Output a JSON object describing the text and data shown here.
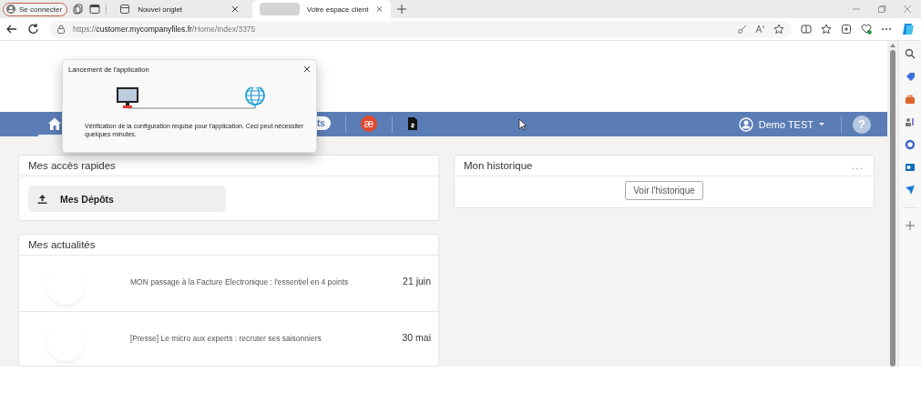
{
  "browser": {
    "profile_button": "Se connecter",
    "tabs": [
      {
        "label": "Nouvel onglet",
        "selected": false
      },
      {
        "label": "Votre espace client",
        "selected": true
      }
    ],
    "url": "https://**customer.mycompanyfiles.fr**/Home/Index/3375"
  },
  "nav": {
    "items": [
      {
        "kind": "home",
        "selected": true
      },
      {
        "kind": "pill",
        "label": "ts",
        "selected": false
      },
      {
        "kind": "logo",
        "label": "æ",
        "selected": false
      },
      {
        "kind": "document",
        "selected": false
      }
    ],
    "user": "Demo TEST",
    "help": "?"
  },
  "quick_access": {
    "title": "Mes accès rapides",
    "items": [
      {
        "label": "Mes Dépôts"
      }
    ]
  },
  "history": {
    "title": "Mon historique",
    "menu": "...",
    "button": "Voir l'historique"
  },
  "news": {
    "title": "Mes actualités",
    "items": [
      {
        "title": "MON passage à la Facture Electronique : l'essentiel en 4 points",
        "date": "21 juin"
      },
      {
        "title": "[Presse] Le micro aux experts : recruter ses saisonniers",
        "date": "30 mai"
      }
    ]
  },
  "dialog": {
    "title": "Lancement de l'application",
    "message": "Vérification de la configuration requise pour l'application. Ceci peut nécessiter quelques minutes."
  }
}
